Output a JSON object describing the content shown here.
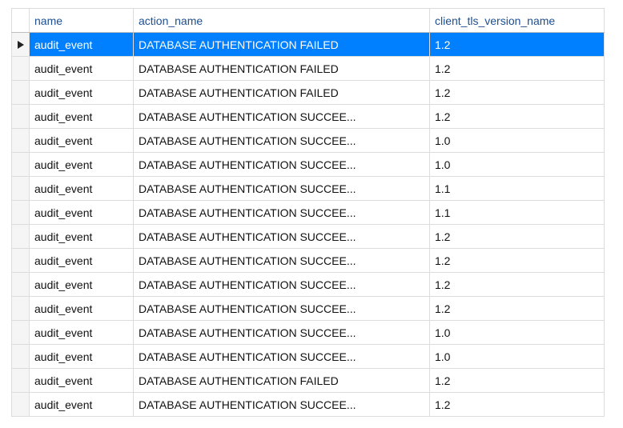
{
  "columns": {
    "name": "name",
    "action": "action_name",
    "tls": "client_tls_version_name"
  },
  "rows": [
    {
      "name": "audit_event",
      "action": "DATABASE AUTHENTICATION FAILED",
      "tls": "1.2",
      "selected": true
    },
    {
      "name": "audit_event",
      "action": "DATABASE AUTHENTICATION FAILED",
      "tls": "1.2",
      "selected": false
    },
    {
      "name": "audit_event",
      "action": "DATABASE AUTHENTICATION FAILED",
      "tls": "1.2",
      "selected": false
    },
    {
      "name": "audit_event",
      "action": "DATABASE AUTHENTICATION SUCCEE...",
      "tls": "1.2",
      "selected": false
    },
    {
      "name": "audit_event",
      "action": "DATABASE AUTHENTICATION SUCCEE...",
      "tls": "1.0",
      "selected": false
    },
    {
      "name": "audit_event",
      "action": "DATABASE AUTHENTICATION SUCCEE...",
      "tls": "1.0",
      "selected": false
    },
    {
      "name": "audit_event",
      "action": "DATABASE AUTHENTICATION SUCCEE...",
      "tls": "1.1",
      "selected": false
    },
    {
      "name": "audit_event",
      "action": "DATABASE AUTHENTICATION SUCCEE...",
      "tls": "1.1",
      "selected": false
    },
    {
      "name": "audit_event",
      "action": "DATABASE AUTHENTICATION SUCCEE...",
      "tls": "1.2",
      "selected": false
    },
    {
      "name": "audit_event",
      "action": "DATABASE AUTHENTICATION SUCCEE...",
      "tls": "1.2",
      "selected": false
    },
    {
      "name": "audit_event",
      "action": "DATABASE AUTHENTICATION SUCCEE...",
      "tls": "1.2",
      "selected": false
    },
    {
      "name": "audit_event",
      "action": "DATABASE AUTHENTICATION SUCCEE...",
      "tls": "1.2",
      "selected": false
    },
    {
      "name": "audit_event",
      "action": "DATABASE AUTHENTICATION SUCCEE...",
      "tls": "1.0",
      "selected": false
    },
    {
      "name": "audit_event",
      "action": "DATABASE AUTHENTICATION SUCCEE...",
      "tls": "1.0",
      "selected": false
    },
    {
      "name": "audit_event",
      "action": "DATABASE AUTHENTICATION FAILED",
      "tls": "1.2",
      "selected": false
    },
    {
      "name": "audit_event",
      "action": "DATABASE AUTHENTICATION SUCCEE...",
      "tls": "1.2",
      "selected": false
    }
  ]
}
